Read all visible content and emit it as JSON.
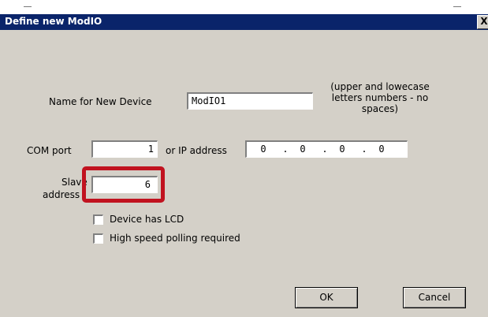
{
  "dialog": {
    "title": "Define new ModIO",
    "close_glyph": "X"
  },
  "device_name": {
    "label": "Name for New Device",
    "value": "ModIO1",
    "hint_lines": [
      "(upper and lowecase",
      "letters numbers - no",
      "spaces)"
    ]
  },
  "com": {
    "label": "COM port",
    "value": "1"
  },
  "ip": {
    "label": "or IP address",
    "octets": [
      "0",
      "0",
      "0",
      "0"
    ],
    "separator": "."
  },
  "slave": {
    "label_lines": [
      "Slave",
      "address"
    ],
    "value": "6"
  },
  "options": [
    {
      "label": "Device has LCD",
      "checked": false
    },
    {
      "label": "High speed polling required",
      "checked": false
    }
  ],
  "buttons": {
    "ok": "OK",
    "cancel": "Cancel"
  },
  "colors": {
    "titlebar": "#0a246a",
    "dialog_bg": "#d4d0c8",
    "highlight": "#c1121f"
  }
}
